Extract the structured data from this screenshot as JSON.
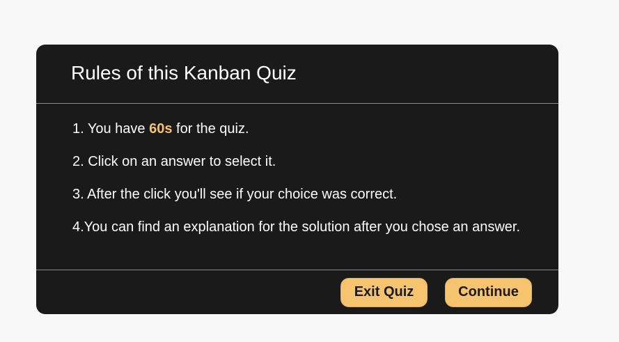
{
  "dialog": {
    "title": "Rules of this Kanban Quiz",
    "rules": [
      {
        "prefix": "1. You have ",
        "highlight": "60s",
        "suffix": " for the quiz."
      },
      {
        "text": "2. Click on an answer to select it."
      },
      {
        "text": "3. After the click you'll see if your choice was correct."
      },
      {
        "text": "4.You can find an explanation for the solution after you chose an answer."
      }
    ],
    "highlight_color": "#f6c36e",
    "background_color": "#1a1a1a"
  },
  "footer": {
    "exit_label": "Exit Quiz",
    "continue_label": "Continue",
    "button_color": "#f6c36e"
  }
}
